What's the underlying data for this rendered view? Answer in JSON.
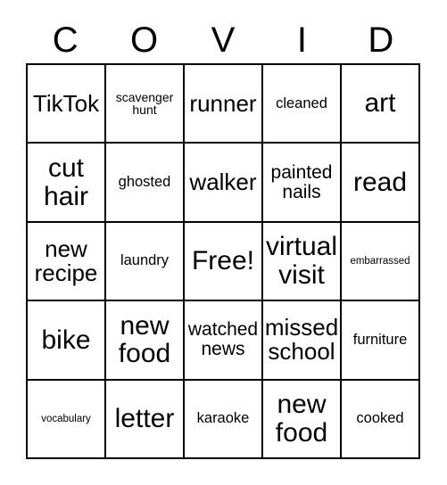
{
  "card": {
    "title_letters": [
      "C",
      "O",
      "V",
      "I",
      "D"
    ],
    "columns": 5,
    "rows": 5,
    "colors": {
      "background": "#ffffff",
      "text": "#000000",
      "border": "#000000"
    },
    "cells": [
      {
        "text": "TikTok",
        "size": "xl"
      },
      {
        "text": "scavenger\nhunt",
        "size": "sm"
      },
      {
        "text": "runner",
        "size": "xl"
      },
      {
        "text": "cleaned",
        "size": "md"
      },
      {
        "text": "art",
        "size": "xxl"
      },
      {
        "text": "cut\nhair",
        "size": "xxl"
      },
      {
        "text": "ghosted",
        "size": "md"
      },
      {
        "text": "walker",
        "size": "xl"
      },
      {
        "text": "painted\nnails",
        "size": "lg"
      },
      {
        "text": "read",
        "size": "xxl"
      },
      {
        "text": "new\nrecipe",
        "size": "xl"
      },
      {
        "text": "laundry",
        "size": "md"
      },
      {
        "text": "Free!",
        "size": "xxl"
      },
      {
        "text": "virtual\nvisit",
        "size": "xxl"
      },
      {
        "text": "embarrassed",
        "size": "xs"
      },
      {
        "text": "bike",
        "size": "xxl"
      },
      {
        "text": "new\nfood",
        "size": "xxl"
      },
      {
        "text": "watched\nnews",
        "size": "lg"
      },
      {
        "text": "missed\nschool",
        "size": "xl"
      },
      {
        "text": "furniture",
        "size": "md"
      },
      {
        "text": "vocabulary",
        "size": "xs"
      },
      {
        "text": "letter",
        "size": "xxl"
      },
      {
        "text": "karaoke",
        "size": "md"
      },
      {
        "text": "new\nfood",
        "size": "xxl"
      },
      {
        "text": "cooked",
        "size": "md"
      }
    ]
  }
}
